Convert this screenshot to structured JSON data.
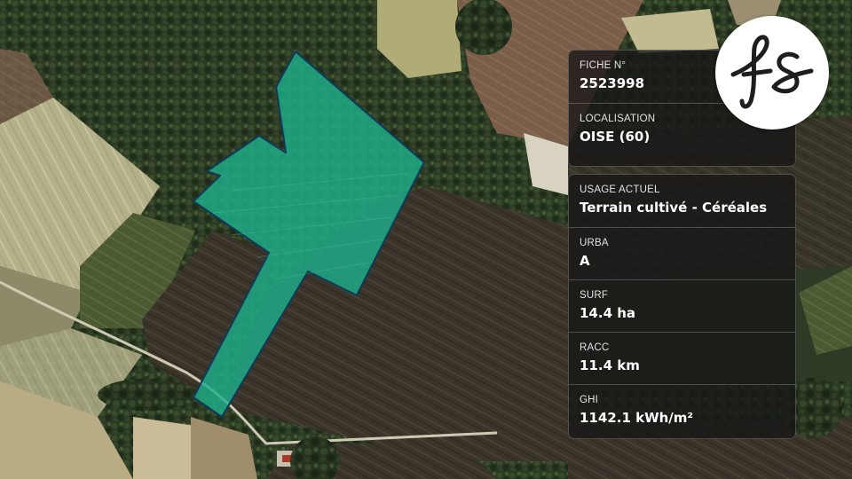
{
  "parcel": {
    "fill_color": "#1fae8a",
    "outline_color": "#123a55"
  },
  "logo": {
    "text": "fs",
    "icon": "fs-monogram-logo",
    "ink_color": "#1e1e1e"
  },
  "card_top": {
    "fiche_label": "FICHE N°",
    "fiche_value": "2523998",
    "localisation_label": "LOCALISATION",
    "localisation_value": "OISE (60)"
  },
  "card_bottom": {
    "usage_label": "USAGE ACTUEL",
    "usage_value": "Terrain cultivé - Céréales",
    "urba_label": "URBA",
    "urba_value": "A",
    "surf_label": "SURF",
    "surf_value": "14.4 ha",
    "racc_label": "RACC",
    "racc_value": "11.4 km",
    "ghi_label": "GHI",
    "ghi_value": "1142.1 kWh/m²"
  }
}
